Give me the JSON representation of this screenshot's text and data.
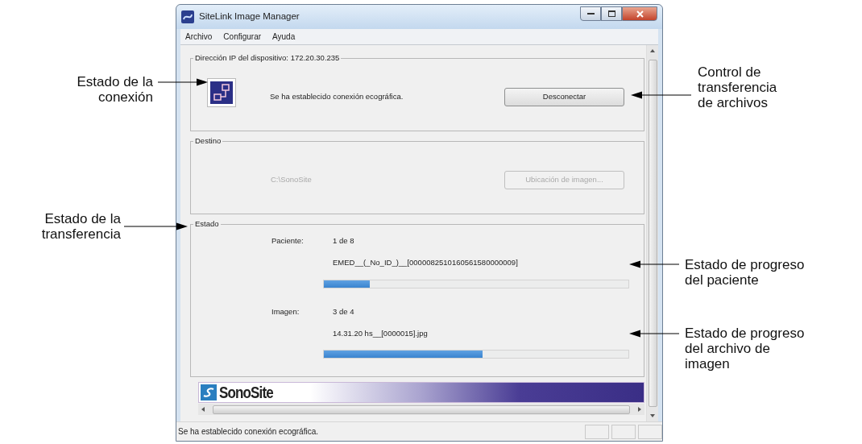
{
  "window": {
    "title": "SiteLink Image Manager"
  },
  "menu": [
    {
      "label": "Archivo"
    },
    {
      "label": "Configurar"
    },
    {
      "label": "Ayuda"
    }
  ],
  "connection": {
    "legend": "Dirección IP del dispositivo: 172.20.30.235",
    "message": "Se ha establecido conexión ecográfica.",
    "button": "Desconectar"
  },
  "destination": {
    "legend": "Destino",
    "path": "C:\\SonoSite",
    "button": "Ubicación de imagen...",
    "disabled": true
  },
  "transfer": {
    "legend": "Estado",
    "rows": [
      {
        "label": "Paciente:",
        "count": "1 de 8",
        "item": "EMED__(_No_ID_)__[0000082510160561580000009]",
        "level": 0.15
      },
      {
        "label": "Imagen:",
        "count": "3 de 4",
        "item": "14.31.20 hs__[0000015].jpg",
        "level": 0.52
      }
    ]
  },
  "banner": {
    "brand": "SonoSite"
  },
  "status_bar": "Se ha establecido conexión ecográfica.",
  "callouts": [
    {
      "text": "Estado de la\nconexión"
    },
    {
      "text": "Estado de la\ntransferencia"
    },
    {
      "text": "Control de\ntransferencia\nde archivos"
    },
    {
      "text": "Estado de progreso\ndel paciente"
    },
    {
      "text": "Estado de progreso\ndel archivo de\nimagen"
    }
  ]
}
